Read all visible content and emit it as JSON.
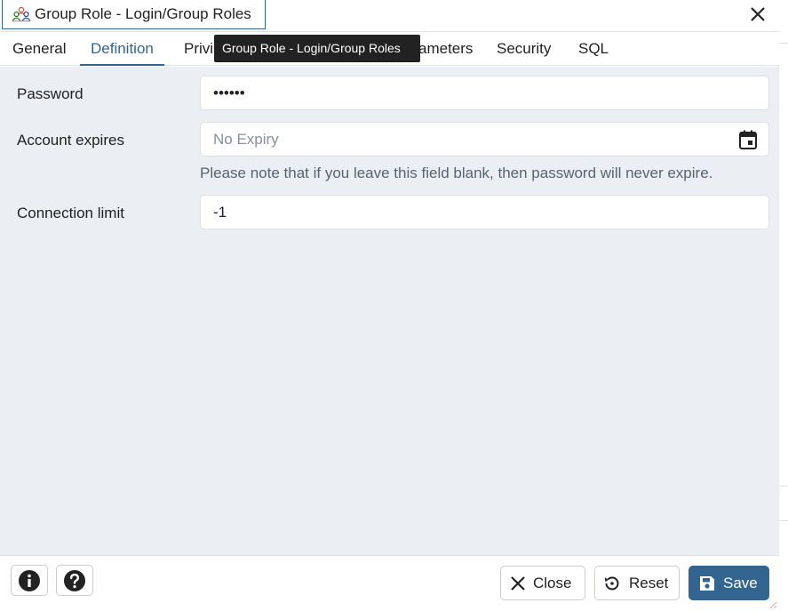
{
  "window": {
    "title": "Group Role - Login/Group Roles",
    "tooltip": "Group Role - Login/Group Roles"
  },
  "tabs": [
    {
      "label": "General"
    },
    {
      "label": "Definition"
    },
    {
      "label": "Privi"
    },
    {
      "label": "ameters"
    },
    {
      "label": "Security"
    },
    {
      "label": "SQL"
    }
  ],
  "form": {
    "password": {
      "label": "Password",
      "value": "••••••"
    },
    "account_expires": {
      "label": "Account expires",
      "placeholder": "No Expiry",
      "hint": "Please note that if you leave this field blank, then password will never expire."
    },
    "connection_limit": {
      "label": "Connection limit",
      "value": "-1"
    }
  },
  "footer": {
    "close_label": "Close",
    "reset_label": "Reset",
    "save_label": "Save"
  },
  "colors": {
    "accent": "#326690",
    "body_bg": "#ebeef3"
  }
}
